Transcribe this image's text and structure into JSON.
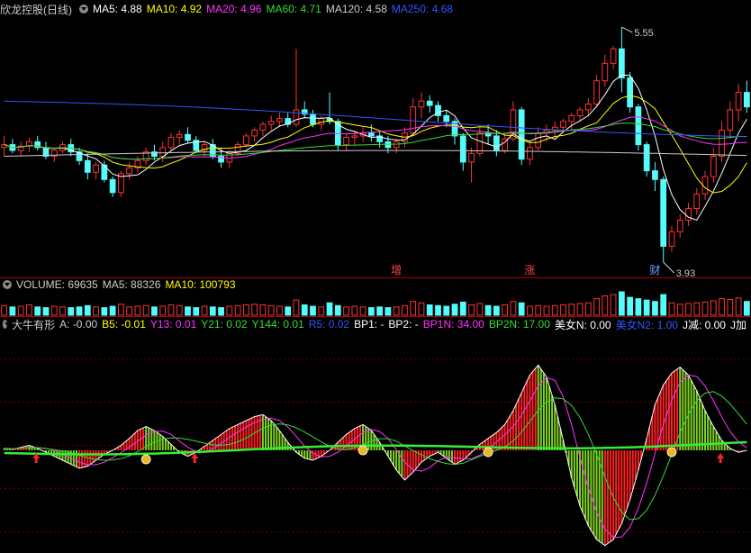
{
  "main": {
    "title": "欣龙控股(日线)",
    "ma": [
      {
        "label": "MA5: 4.88",
        "color": "#ffffff"
      },
      {
        "label": "MA10: 4.92",
        "color": "#ffff00"
      },
      {
        "label": "MA20: 4.96",
        "color": "#ff33ff"
      },
      {
        "label": "MA60: 4.71",
        "color": "#33dd33"
      },
      {
        "label": "MA120: 4.58",
        "color": "#cccccc"
      },
      {
        "label": "MA250: 4.68",
        "color": "#3355ff"
      }
    ],
    "high_label": "5.55",
    "low_label": "3.93",
    "markers": [
      {
        "text": "增"
      },
      {
        "text": "涨"
      },
      {
        "text": "财"
      }
    ]
  },
  "volume": {
    "items": [
      {
        "label": "VOLUME: 69635",
        "color": "#cccccc"
      },
      {
        "label": "MA5: 88326",
        "color": "#cccccc"
      },
      {
        "label": "MA10: 100793",
        "color": "#ffff00"
      }
    ]
  },
  "indicator": {
    "items": [
      {
        "label": "大牛有形",
        "color": "#cccccc"
      },
      {
        "label": "A: -0.00",
        "color": "#cccccc"
      },
      {
        "label": "B5: -0.01",
        "color": "#ffff00"
      },
      {
        "label": "Y13: 0.01",
        "color": "#ff33ff"
      },
      {
        "label": "Y21: 0.02",
        "color": "#33dd33"
      },
      {
        "label": "Y144: 0.01",
        "color": "#33dd33"
      },
      {
        "label": "R5: 0.02",
        "color": "#3355ff"
      },
      {
        "label": "BP1: -",
        "color": "#ffffff"
      },
      {
        "label": "BP2: -",
        "color": "#ffffff"
      },
      {
        "label": "BP1N: 34.00",
        "color": "#ff33ff"
      },
      {
        "label": "BP2N: 17.00",
        "color": "#33dd33"
      },
      {
        "label": "美女N: 0.00",
        "color": "#ffffff"
      },
      {
        "label": "美女N2: 1.00",
        "color": "#3355ff"
      },
      {
        "label": "J减: 0.00",
        "color": "#ffffff"
      },
      {
        "label": "J加",
        "color": "#ffffff"
      }
    ]
  },
  "chart_data": {
    "type": "candlestick",
    "ylim": [
      3.9,
      5.6
    ],
    "ohlc": [
      [
        4.72,
        4.8,
        4.66,
        4.74
      ],
      [
        4.74,
        4.78,
        4.68,
        4.7
      ],
      [
        4.7,
        4.76,
        4.66,
        4.73
      ],
      [
        4.73,
        4.79,
        4.69,
        4.76
      ],
      [
        4.76,
        4.8,
        4.7,
        4.72
      ],
      [
        4.72,
        4.76,
        4.64,
        4.66
      ],
      [
        4.66,
        4.72,
        4.62,
        4.7
      ],
      [
        4.7,
        4.76,
        4.68,
        4.74
      ],
      [
        4.74,
        4.78,
        4.66,
        4.69
      ],
      [
        4.69,
        4.72,
        4.6,
        4.63
      ],
      [
        4.63,
        4.68,
        4.5,
        4.55
      ],
      [
        4.55,
        4.62,
        4.5,
        4.6
      ],
      [
        4.6,
        4.63,
        4.48,
        4.5
      ],
      [
        4.5,
        4.52,
        4.38,
        4.41
      ],
      [
        4.41,
        4.56,
        4.38,
        4.54
      ],
      [
        4.54,
        4.62,
        4.5,
        4.58
      ],
      [
        4.58,
        4.66,
        4.55,
        4.63
      ],
      [
        4.63,
        4.72,
        4.6,
        4.69
      ],
      [
        4.69,
        4.74,
        4.63,
        4.66
      ],
      [
        4.66,
        4.76,
        4.62,
        4.72
      ],
      [
        4.72,
        4.82,
        4.7,
        4.79
      ],
      [
        4.79,
        4.84,
        4.74,
        4.81
      ],
      [
        4.81,
        4.86,
        4.75,
        4.77
      ],
      [
        4.77,
        4.8,
        4.68,
        4.7
      ],
      [
        4.7,
        4.76,
        4.66,
        4.74
      ],
      [
        4.74,
        4.78,
        4.64,
        4.66
      ],
      [
        4.66,
        4.72,
        4.58,
        4.62
      ],
      [
        4.62,
        4.7,
        4.58,
        4.68
      ],
      [
        4.68,
        4.76,
        4.66,
        4.74
      ],
      [
        4.74,
        4.82,
        4.72,
        4.8
      ],
      [
        4.8,
        4.86,
        4.76,
        4.84
      ],
      [
        4.84,
        4.9,
        4.8,
        4.88
      ],
      [
        4.88,
        4.94,
        4.84,
        4.9
      ],
      [
        4.9,
        4.96,
        4.86,
        4.92
      ],
      [
        4.92,
        4.96,
        4.86,
        4.88
      ],
      [
        4.88,
        5.4,
        4.86,
        4.98
      ],
      [
        4.98,
        5.04,
        4.92,
        4.95
      ],
      [
        4.95,
        4.98,
        4.86,
        4.88
      ],
      [
        4.88,
        4.94,
        4.84,
        4.92
      ],
      [
        4.92,
        5.1,
        4.88,
        4.9
      ],
      [
        4.9,
        4.92,
        4.7,
        4.74
      ],
      [
        4.74,
        4.82,
        4.7,
        4.79
      ],
      [
        4.79,
        4.84,
        4.74,
        4.8
      ],
      [
        4.8,
        4.86,
        4.76,
        4.82
      ],
      [
        4.82,
        4.88,
        4.76,
        4.8
      ],
      [
        4.8,
        4.84,
        4.72,
        4.76
      ],
      [
        4.76,
        4.8,
        4.68,
        4.72
      ],
      [
        4.72,
        4.78,
        4.68,
        4.76
      ],
      [
        4.76,
        4.86,
        4.72,
        4.82
      ],
      [
        4.82,
        5.06,
        4.8,
        5.0
      ],
      [
        5.0,
        5.1,
        4.92,
        5.04
      ],
      [
        5.04,
        5.08,
        4.96,
        5.01
      ],
      [
        5.01,
        5.04,
        4.9,
        4.94
      ],
      [
        4.94,
        4.98,
        4.86,
        4.9
      ],
      [
        4.9,
        4.92,
        4.74,
        4.8
      ],
      [
        4.8,
        4.82,
        4.56,
        4.62
      ],
      [
        4.62,
        4.72,
        4.48,
        4.68
      ],
      [
        4.68,
        4.86,
        4.66,
        4.82
      ],
      [
        4.82,
        4.88,
        4.74,
        4.8
      ],
      [
        4.8,
        4.84,
        4.66,
        4.7
      ],
      [
        4.7,
        4.82,
        4.68,
        4.78
      ],
      [
        4.78,
        5.04,
        4.76,
        4.98
      ],
      [
        4.98,
        5.0,
        4.6,
        4.64
      ],
      [
        4.64,
        4.76,
        4.6,
        4.72
      ],
      [
        4.72,
        4.86,
        4.7,
        4.82
      ],
      [
        4.82,
        4.88,
        4.76,
        4.84
      ],
      [
        4.84,
        4.9,
        4.78,
        4.86
      ],
      [
        4.86,
        4.92,
        4.82,
        4.9
      ],
      [
        4.9,
        4.96,
        4.84,
        4.94
      ],
      [
        4.94,
        5.0,
        4.9,
        4.98
      ],
      [
        4.98,
        5.06,
        4.94,
        5.02
      ],
      [
        5.02,
        5.22,
        5.0,
        5.18
      ],
      [
        5.18,
        5.36,
        5.14,
        5.3
      ],
      [
        5.3,
        5.42,
        5.26,
        5.4
      ],
      [
        5.4,
        5.55,
        5.1,
        5.2
      ],
      [
        5.2,
        5.24,
        4.96,
        5.0
      ],
      [
        5.0,
        5.02,
        4.7,
        4.74
      ],
      [
        4.74,
        4.76,
        4.52,
        4.56
      ],
      [
        4.56,
        4.62,
        4.42,
        4.5
      ],
      [
        4.5,
        4.52,
        3.93,
        4.04
      ],
      [
        4.04,
        4.18,
        4.0,
        4.14
      ],
      [
        4.14,
        4.26,
        4.1,
        4.22
      ],
      [
        4.22,
        4.34,
        4.18,
        4.3
      ],
      [
        4.3,
        4.44,
        4.26,
        4.4
      ],
      [
        4.4,
        4.56,
        4.36,
        4.52
      ],
      [
        4.52,
        4.72,
        4.48,
        4.66
      ],
      [
        4.66,
        4.9,
        4.62,
        4.84
      ],
      [
        4.84,
        5.04,
        4.78,
        4.98
      ],
      [
        4.98,
        5.16,
        4.9,
        5.1
      ],
      [
        5.1,
        5.18,
        4.96,
        5.0
      ]
    ],
    "volume": [
      14,
      12,
      13,
      15,
      12,
      11,
      13,
      12,
      11,
      12,
      14,
      12,
      11,
      13,
      16,
      12,
      13,
      14,
      12,
      13,
      15,
      14,
      12,
      11,
      13,
      12,
      11,
      13,
      14,
      15,
      16,
      15,
      14,
      13,
      12,
      22,
      15,
      13,
      12,
      18,
      14,
      12,
      13,
      12,
      11,
      12,
      11,
      12,
      14,
      20,
      18,
      15,
      14,
      13,
      16,
      19,
      15,
      17,
      14,
      13,
      15,
      20,
      18,
      13,
      14,
      13,
      14,
      15,
      16,
      17,
      18,
      24,
      28,
      30,
      34,
      26,
      24,
      22,
      20,
      30,
      18,
      16,
      17,
      18,
      19,
      21,
      24,
      23,
      25,
      20
    ],
    "indicator": [
      0.02,
      0.01,
      0.03,
      0.05,
      0.02,
      -0.02,
      -0.06,
      -0.1,
      -0.14,
      -0.18,
      -0.16,
      -0.1,
      -0.04,
      0.0,
      0.05,
      0.12,
      0.2,
      0.24,
      0.2,
      0.14,
      0.06,
      -0.02,
      -0.06,
      -0.02,
      0.04,
      0.1,
      0.16,
      0.22,
      0.26,
      0.3,
      0.34,
      0.36,
      0.3,
      0.2,
      0.08,
      -0.02,
      -0.08,
      -0.1,
      -0.06,
      0.0,
      0.08,
      0.16,
      0.22,
      0.26,
      0.2,
      0.08,
      -0.06,
      -0.2,
      -0.3,
      -0.22,
      -0.12,
      -0.06,
      -0.02,
      -0.08,
      -0.14,
      -0.1,
      -0.02,
      0.06,
      0.12,
      0.18,
      0.26,
      0.4,
      0.58,
      0.76,
      0.86,
      0.74,
      0.46,
      0.1,
      -0.28,
      -0.56,
      -0.76,
      -0.9,
      -0.96,
      -0.9,
      -0.74,
      -0.5,
      -0.2,
      0.12,
      0.46,
      0.66,
      0.78,
      0.84,
      0.76,
      0.6,
      0.4,
      0.24,
      0.1,
      0.02,
      -0.02,
      0.0
    ]
  }
}
